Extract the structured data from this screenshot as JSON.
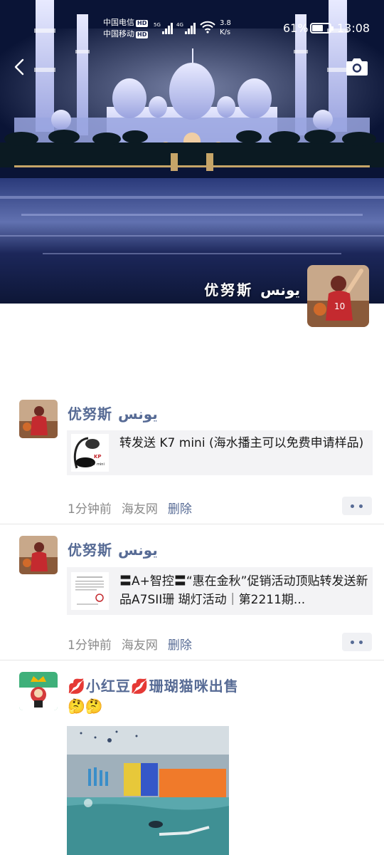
{
  "status_bar": {
    "carrier_1": "中国电信",
    "carrier_2": "中国移动",
    "hd_badge": "HD",
    "network_1": "5G",
    "network_2": "4G",
    "speed_value": "3.8",
    "speed_unit": "K/s",
    "battery_percent": "61%",
    "battery_level": 0.61,
    "time": "13:08"
  },
  "header": {
    "back_icon": "chevron-left-icon",
    "camera_icon": "camera-icon"
  },
  "profile": {
    "cover_name": "优努斯 يونس"
  },
  "posts": [
    {
      "author": "优努斯 يونس",
      "share_text": "转发送 K7 mini (海水播主可以免费申请样品)",
      "thumb_label": "K7 mini",
      "time": "1分钟前",
      "source": "海友网",
      "delete_label": "删除"
    },
    {
      "author": "优努斯 يونس",
      "share_text": "〓A+智控〓“惠在金秋”促销活动顶贴转发送新品A7SII珊 瑚灯活动｜第2211期...",
      "time": "1分钟前",
      "source": "海友网",
      "delete_label": "删除"
    },
    {
      "author": "💋小红豆💋珊瑚猫咪出售",
      "text": "🤔🤔"
    }
  ],
  "colors": {
    "link": "#576b95",
    "meta": "#8a8a8a",
    "card_bg": "#f3f3f5"
  }
}
